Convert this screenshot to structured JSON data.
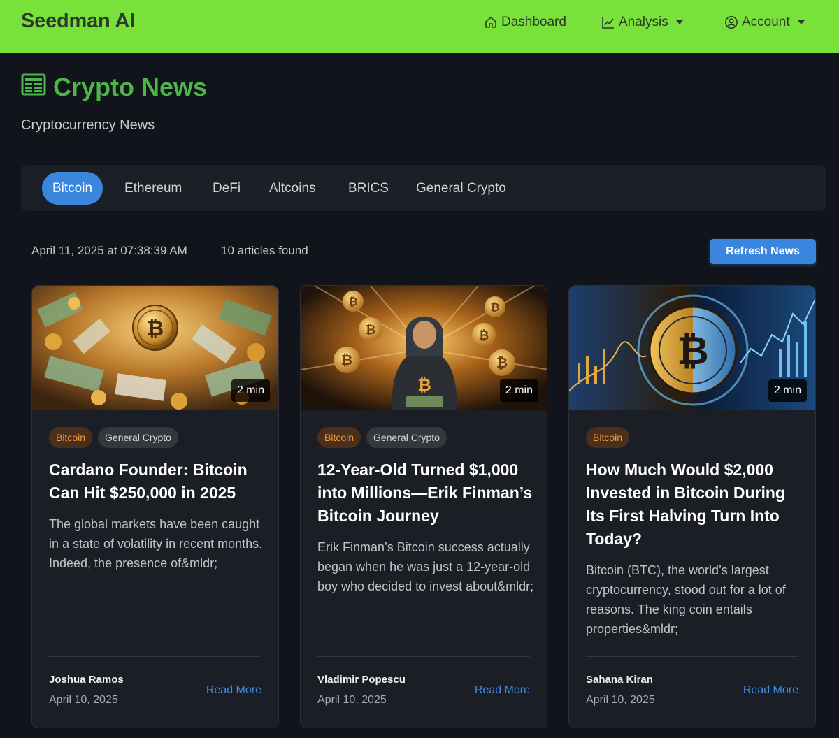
{
  "navbar": {
    "brand": "Seedman AI",
    "dashboard": "Dashboard",
    "analysis": "Analysis",
    "account": "Account",
    "accent": "#79e23a"
  },
  "header": {
    "title": "Crypto News",
    "subtitle": "Cryptocurrency News",
    "title_color": "#4cb748"
  },
  "tabs": [
    "Bitcoin",
    "Ethereum",
    "DeFi",
    "Altcoins",
    "BRICS",
    "General Crypto"
  ],
  "active_tab": "Bitcoin",
  "info": {
    "timestamp": "April 11, 2025 at 07:38:39 AM",
    "count": "10 articles found",
    "refresh_label": "Refresh News"
  },
  "articles": [
    {
      "duration": "2 min",
      "tags": [
        "Bitcoin",
        "General Crypto"
      ],
      "title": "Cardano Founder: Bitcoin Can Hit $250,000 in 2025",
      "description": "The global markets have been caught in a state of volatility in recent months. Indeed, the presence of&mldr;",
      "author": "Joshua Ramos",
      "date": "April 10, 2025",
      "read_more": "Read More"
    },
    {
      "duration": "2 min",
      "tags": [
        "Bitcoin",
        "General Crypto"
      ],
      "title": "12-Year-Old Turned $1,000 into Millions—Erik Finman’s Bitcoin Journey",
      "description": "Erik Finman’s Bitcoin success actually began when he was just a 12-year-old boy who decided to invest about&mldr;",
      "author": "Vladimir Popescu",
      "date": "April 10, 2025",
      "read_more": "Read More"
    },
    {
      "duration": "2 min",
      "tags": [
        "Bitcoin"
      ],
      "title": "How Much Would $2,000 Invested in Bitcoin During Its First Halving Turn Into Today?",
      "description": "Bitcoin (BTC), the world’s largest cryptocurrency, stood out for a lot of reasons. The king coin entails properties&mldr;",
      "author": "Sahana Kiran",
      "date": "April 10, 2025",
      "read_more": "Read More"
    }
  ]
}
